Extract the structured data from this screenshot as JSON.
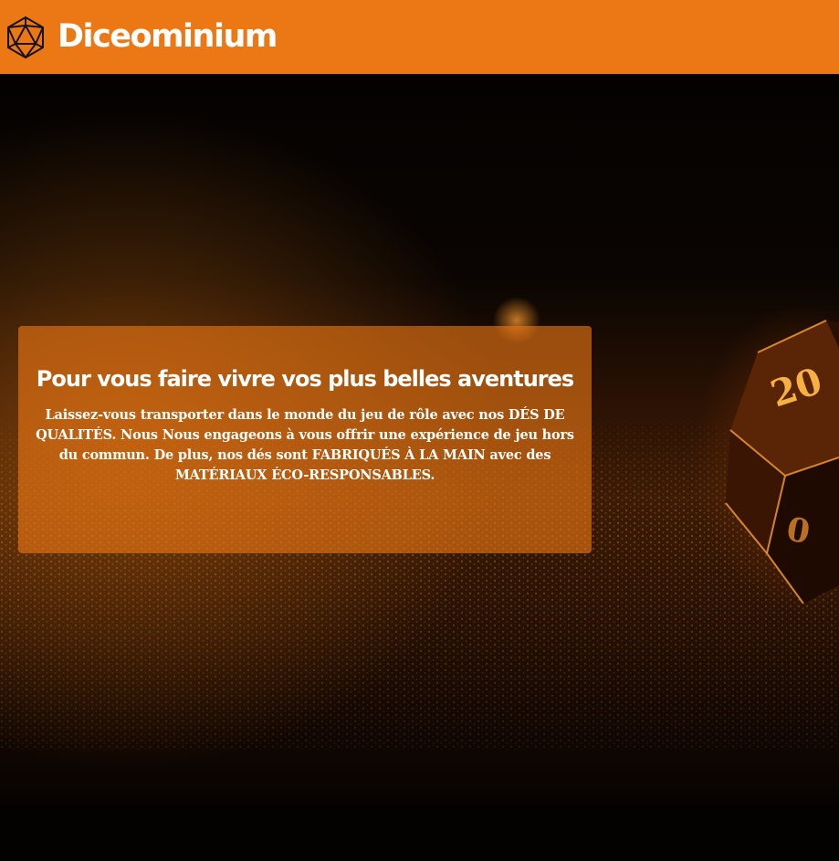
{
  "header": {
    "brand": "Diceominium",
    "logo_icon": "d20-icon",
    "background_color": "#ec7715"
  },
  "hero": {
    "image": "d20-die-on-fabric-photo",
    "card": {
      "title": "Pour vous faire vivre vos plus belles aventures",
      "text": "Laissez-vous transporter dans le monde du jeu de rôle avec nos DÉS DE QUALITÉS. Nous Nous engageons à vous offrir une expérience de jeu hors du commun. De plus, nos dés sont FABRIQUÉS À LA MAIN avec des MATÉRIAUX ÉCO-RESPONSABLES."
    }
  }
}
